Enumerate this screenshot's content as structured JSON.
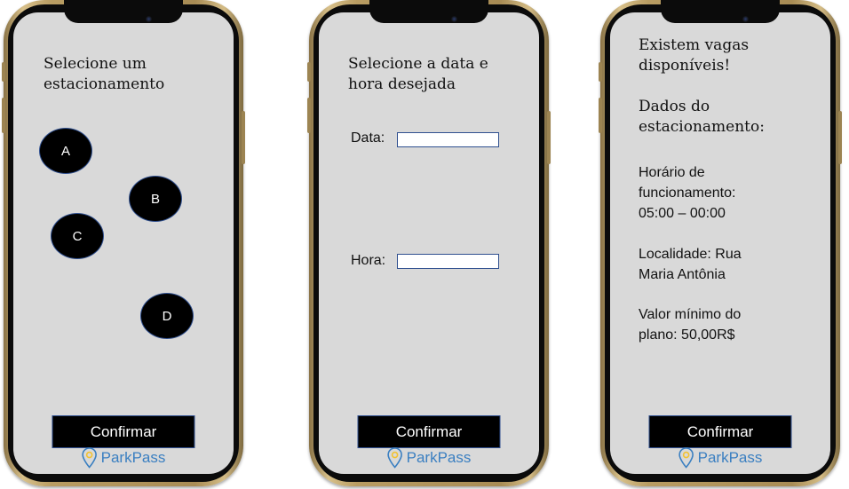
{
  "brand": {
    "name": "ParkPass",
    "color": "#3a7fc1",
    "pin_color": "#f2c230",
    "pin_icon": "location-pin-icon"
  },
  "screens": [
    {
      "title": "Selecione um estacionamento",
      "options": [
        {
          "label": "A"
        },
        {
          "label": "B"
        },
        {
          "label": "C"
        },
        {
          "label": "D"
        }
      ],
      "confirm_label": "Confirmar"
    },
    {
      "title": "Selecione a data e hora desejada",
      "date_label": "Data:",
      "date_value": "",
      "time_label": "Hora:",
      "time_value": "",
      "confirm_label": "Confirmar"
    },
    {
      "heading": "Existem vagas disponíveis!",
      "subheading": "Dados do estacionamento:",
      "hours": "Horário de funcionamento: 05:00 – 00:00",
      "location": "Localidade: Rua Maria Antônia",
      "min_price": "Valor mínimo do plano: 50,00R$",
      "confirm_label": "Confirmar"
    }
  ]
}
